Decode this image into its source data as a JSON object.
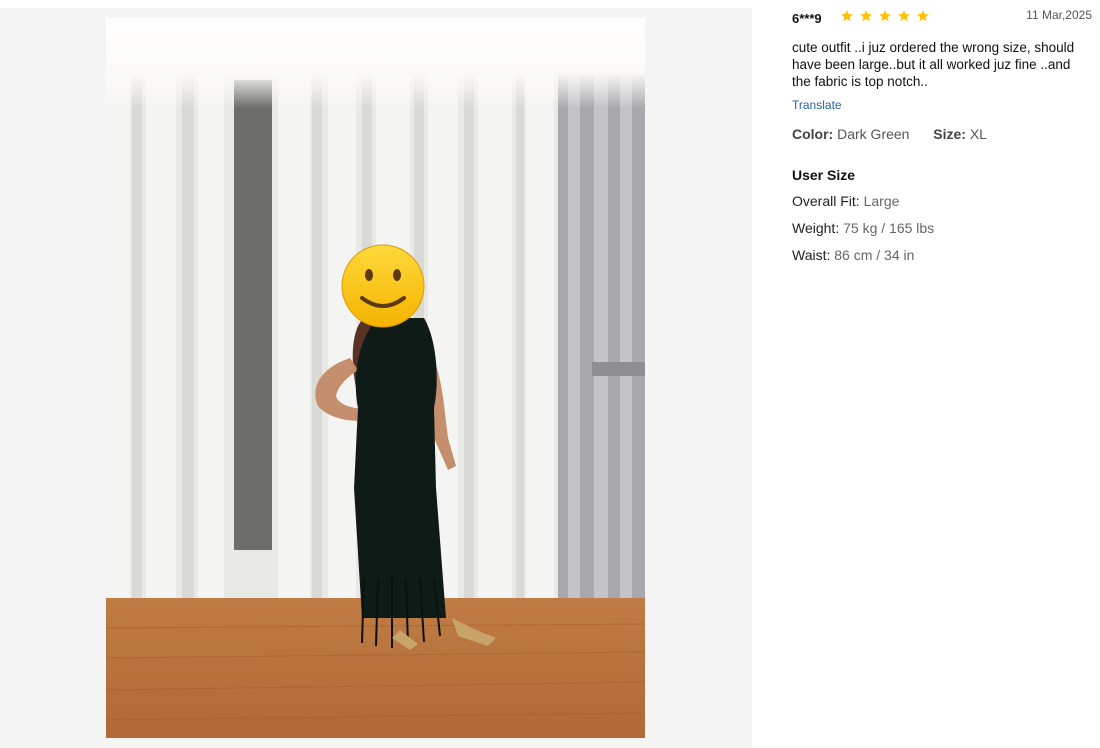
{
  "review": {
    "reviewer": "6***9",
    "rating": 5,
    "date": "11 Mar,2025",
    "text": "cute outfit ..i juz ordered the wrong size, should have been large..but it all worked juz fine ..and the fabric is top notch..",
    "translate_label": "Translate",
    "color_label": "Color:",
    "color_value": "Dark Green",
    "size_label": "Size:",
    "size_value": "XL"
  },
  "user_size": {
    "title": "User Size",
    "overall_fit_label": "Overall Fit:",
    "overall_fit_value": "Large",
    "weight_label": "Weight:",
    "weight_value": "75 kg / 165 lbs",
    "waist_label": "Waist:",
    "waist_value": "86 cm / 34 in"
  },
  "colors": {
    "star": "#ffc107",
    "link": "#2962a8",
    "pane_bg": "#f5f5f5"
  },
  "icons": {
    "star": "star-icon",
    "face_sticker": "smiley-face-icon"
  }
}
